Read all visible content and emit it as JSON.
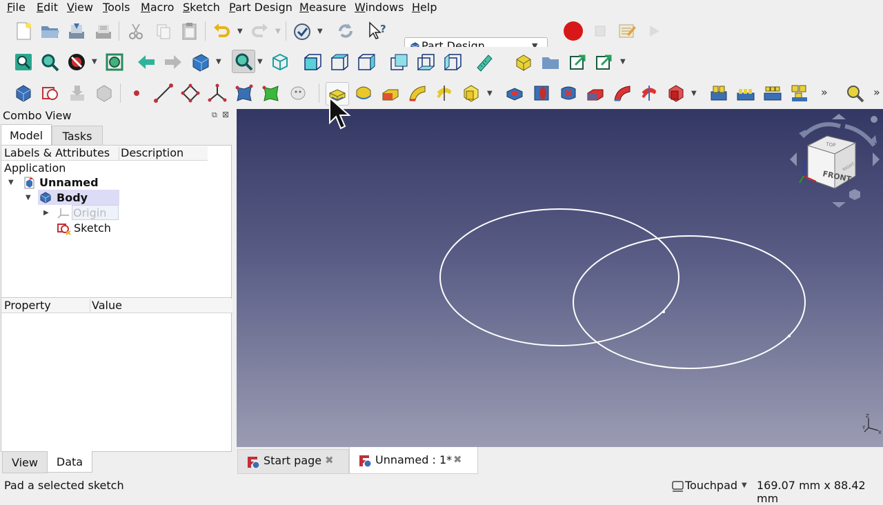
{
  "menu": [
    "File",
    "Edit",
    "View",
    "Tools",
    "Macro",
    "Sketch",
    "Part Design",
    "Measure",
    "Windows",
    "Help"
  ],
  "workbench": "Part Design",
  "combo": {
    "title": "Combo View",
    "tabs": [
      "Model",
      "Tasks"
    ],
    "tree_headers": [
      "Labels & Attributes",
      "Description"
    ],
    "application": "Application",
    "tree": {
      "document": "Unnamed",
      "body": "Body",
      "origin": "Origin",
      "sketch": "Sketch"
    },
    "prop_headers": [
      "Property",
      "Value"
    ],
    "bottom_tabs": [
      "View",
      "Data"
    ]
  },
  "navcube": {
    "face": "FRONT",
    "top": "TOP",
    "right": "RIGHT"
  },
  "doc_tabs": [
    "Start page",
    "Unnamed : 1*"
  ],
  "status": {
    "message": "Pad a selected sketch",
    "nav_style": "Touchpad",
    "dimensions": "169.07 mm x 88.42 mm"
  },
  "colors": {
    "record": "#d81818",
    "accent": "#ffd700",
    "view_top": "#333763",
    "view_bottom": "#9b9cb3"
  }
}
